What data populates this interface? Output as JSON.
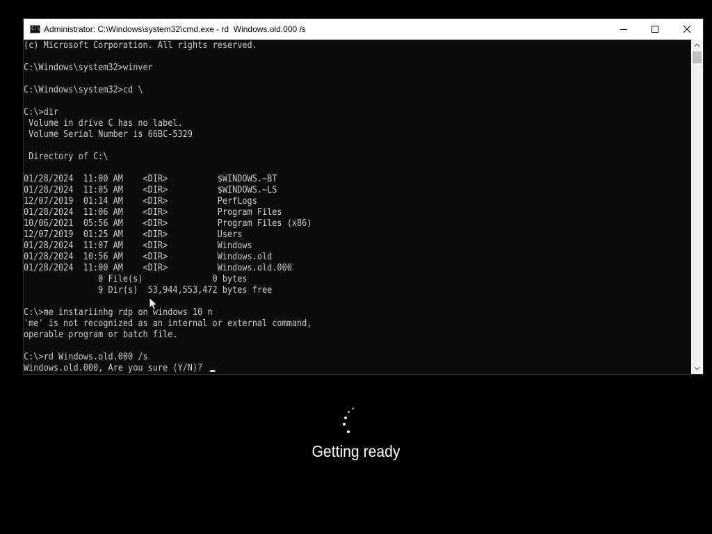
{
  "window": {
    "title": "Administrator: C:\\Windows\\system32\\cmd.exe - rd  Windows.old.000 /s",
    "app_icon_text": "C:\\",
    "buttons": {
      "minimize": "minimize-icon",
      "maximize": "maximize-icon",
      "close": "close-icon"
    }
  },
  "terminal": {
    "colors": {
      "background": "#0c0c0c",
      "text": "#cccccc"
    },
    "lines": [
      "(c) Microsoft Corporation. All rights reserved.",
      "",
      "C:\\Windows\\system32>winver",
      "",
      "C:\\Windows\\system32>cd \\",
      "",
      "C:\\>dir",
      " Volume in drive C has no label.",
      " Volume Serial Number is 66BC-5329",
      "",
      " Directory of C:\\",
      "",
      "01/28/2024  11:00 AM    <DIR>          $WINDOWS.~BT",
      "01/28/2024  11:05 AM    <DIR>          $WINDOWS.~LS",
      "12/07/2019  01:14 AM    <DIR>          PerfLogs",
      "01/28/2024  11:06 AM    <DIR>          Program Files",
      "10/06/2021  05:56 AM    <DIR>          Program Files (x86)",
      "12/07/2019  01:25 AM    <DIR>          Users",
      "01/28/2024  11:07 AM    <DIR>          Windows",
      "01/28/2024  10:56 AM    <DIR>          Windows.old",
      "01/28/2024  11:00 AM    <DIR>          Windows.old.000",
      "               0 File(s)              0 bytes",
      "               9 Dir(s)  53,944,553,472 bytes free",
      "",
      "C:\\>me instariinhg rdp on windows 10 n",
      "'me' is not recognized as an internal or external command,",
      "operable program or batch file.",
      "",
      "C:\\>rd Windows.old.000 /s"
    ],
    "prompt_line": "Windows.old.000, Are you sure (Y/N)? "
  },
  "setup": {
    "status": "Getting ready",
    "spinner_icon": "spinner-icon"
  },
  "cursor_icon": "mouse-pointer-icon"
}
